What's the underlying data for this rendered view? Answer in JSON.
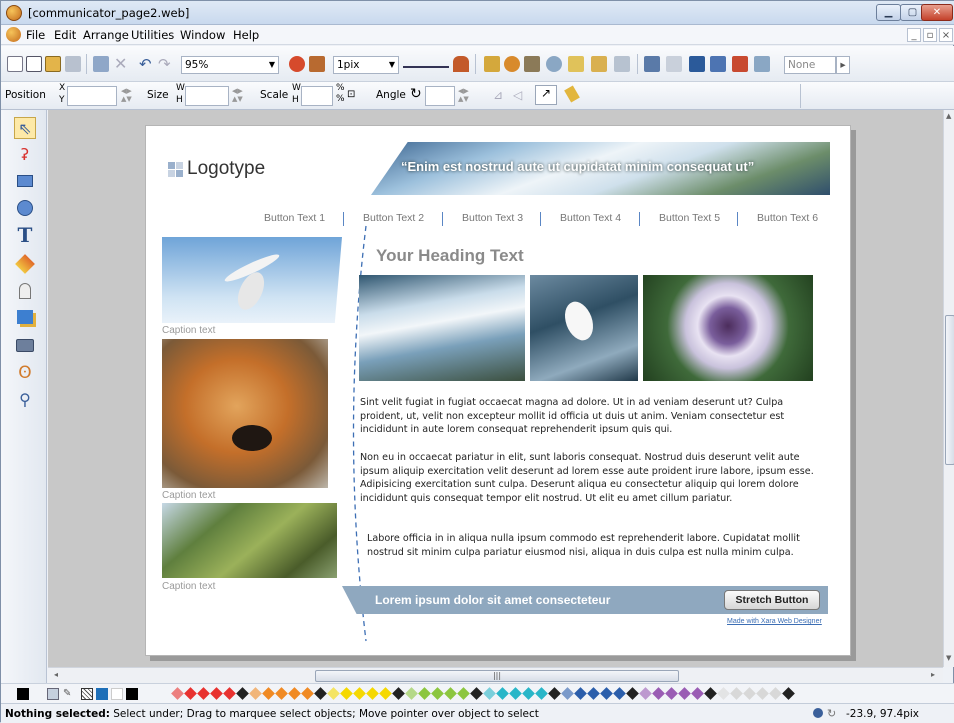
{
  "window": {
    "title": "[communicator_page2.web]"
  },
  "menu": {
    "items": [
      "File",
      "Edit",
      "Arrange",
      "Utilities",
      "Window",
      "Help"
    ]
  },
  "toolbar": {
    "zoom": "95%",
    "line_width": "1pix",
    "fill_none": "None"
  },
  "infobar": {
    "position_label": "Position",
    "x_label": "X",
    "y_label": "Y",
    "size_label": "Size",
    "w_label": "W",
    "h_label": "H",
    "scale_label": "Scale",
    "percent_label": "%",
    "angle_label": "Angle"
  },
  "webpage": {
    "logo_text": "Logotype",
    "banner_text": "“Enim est nostrud aute ut cupidatat minim consequat ut”",
    "nav": [
      "Button Text 1",
      "Button Text 2",
      "Button Text 3",
      "Button Text 4",
      "Button Text 5",
      "Button Text 6"
    ],
    "heading": "Your Heading Text",
    "captions": [
      "Caption text",
      "Caption text",
      "Caption text"
    ],
    "paragraphs": [
      "Sint velit fugiat in fugiat occaecat magna ad dolore. Ut in ad veniam deserunt ut? Culpa proident, ut, velit non excepteur mollit id officia ut duis ut anim. Veniam consectetur est incididunt in aute lorem consequat reprehenderit ipsum quis qui.",
      "Non eu in occaecat pariatur in elit, sunt laboris consequat. Nostrud duis deserunt velit aute ipsum aliquip exercitation velit deserunt ad lorem esse aute proident irure labore, ipsum esse. Adipisicing exercitation sunt culpa. Deserunt aliqua eu consectetur aliquip qui lorem dolore incididunt quis consequat tempor elit nostrud. Ut elit eu amet cillum pariatur.",
      "Labore officia in in aliqua nulla ipsum commodo est reprehenderit labore. Cupidatat mollit nostrud sit minim culpa pariatur eiusmod nisi, aliqua in duis culpa est nulla minim culpa."
    ],
    "stretch_bar_text": "Lorem ipsum dolor sit amet consecteteur",
    "stretch_button": "Stretch Button",
    "made_with": "Made with Xara Web Designer"
  },
  "status": {
    "text_bold": "Nothing selected:",
    "text": " Select under; Drag to marquee select objects; Move pointer over object to select",
    "coords": "-23.9, 97.4pix"
  },
  "palette_colors": [
    "#000000",
    "#ffffff",
    "#1e6fb8",
    "#000000",
    "#e8312f",
    "#f08a24",
    "#f5d800",
    "#8cc63f",
    "#29b6c8",
    "#2b5eab",
    "#9a5cb4",
    "#d8d8d8",
    "#000000"
  ]
}
